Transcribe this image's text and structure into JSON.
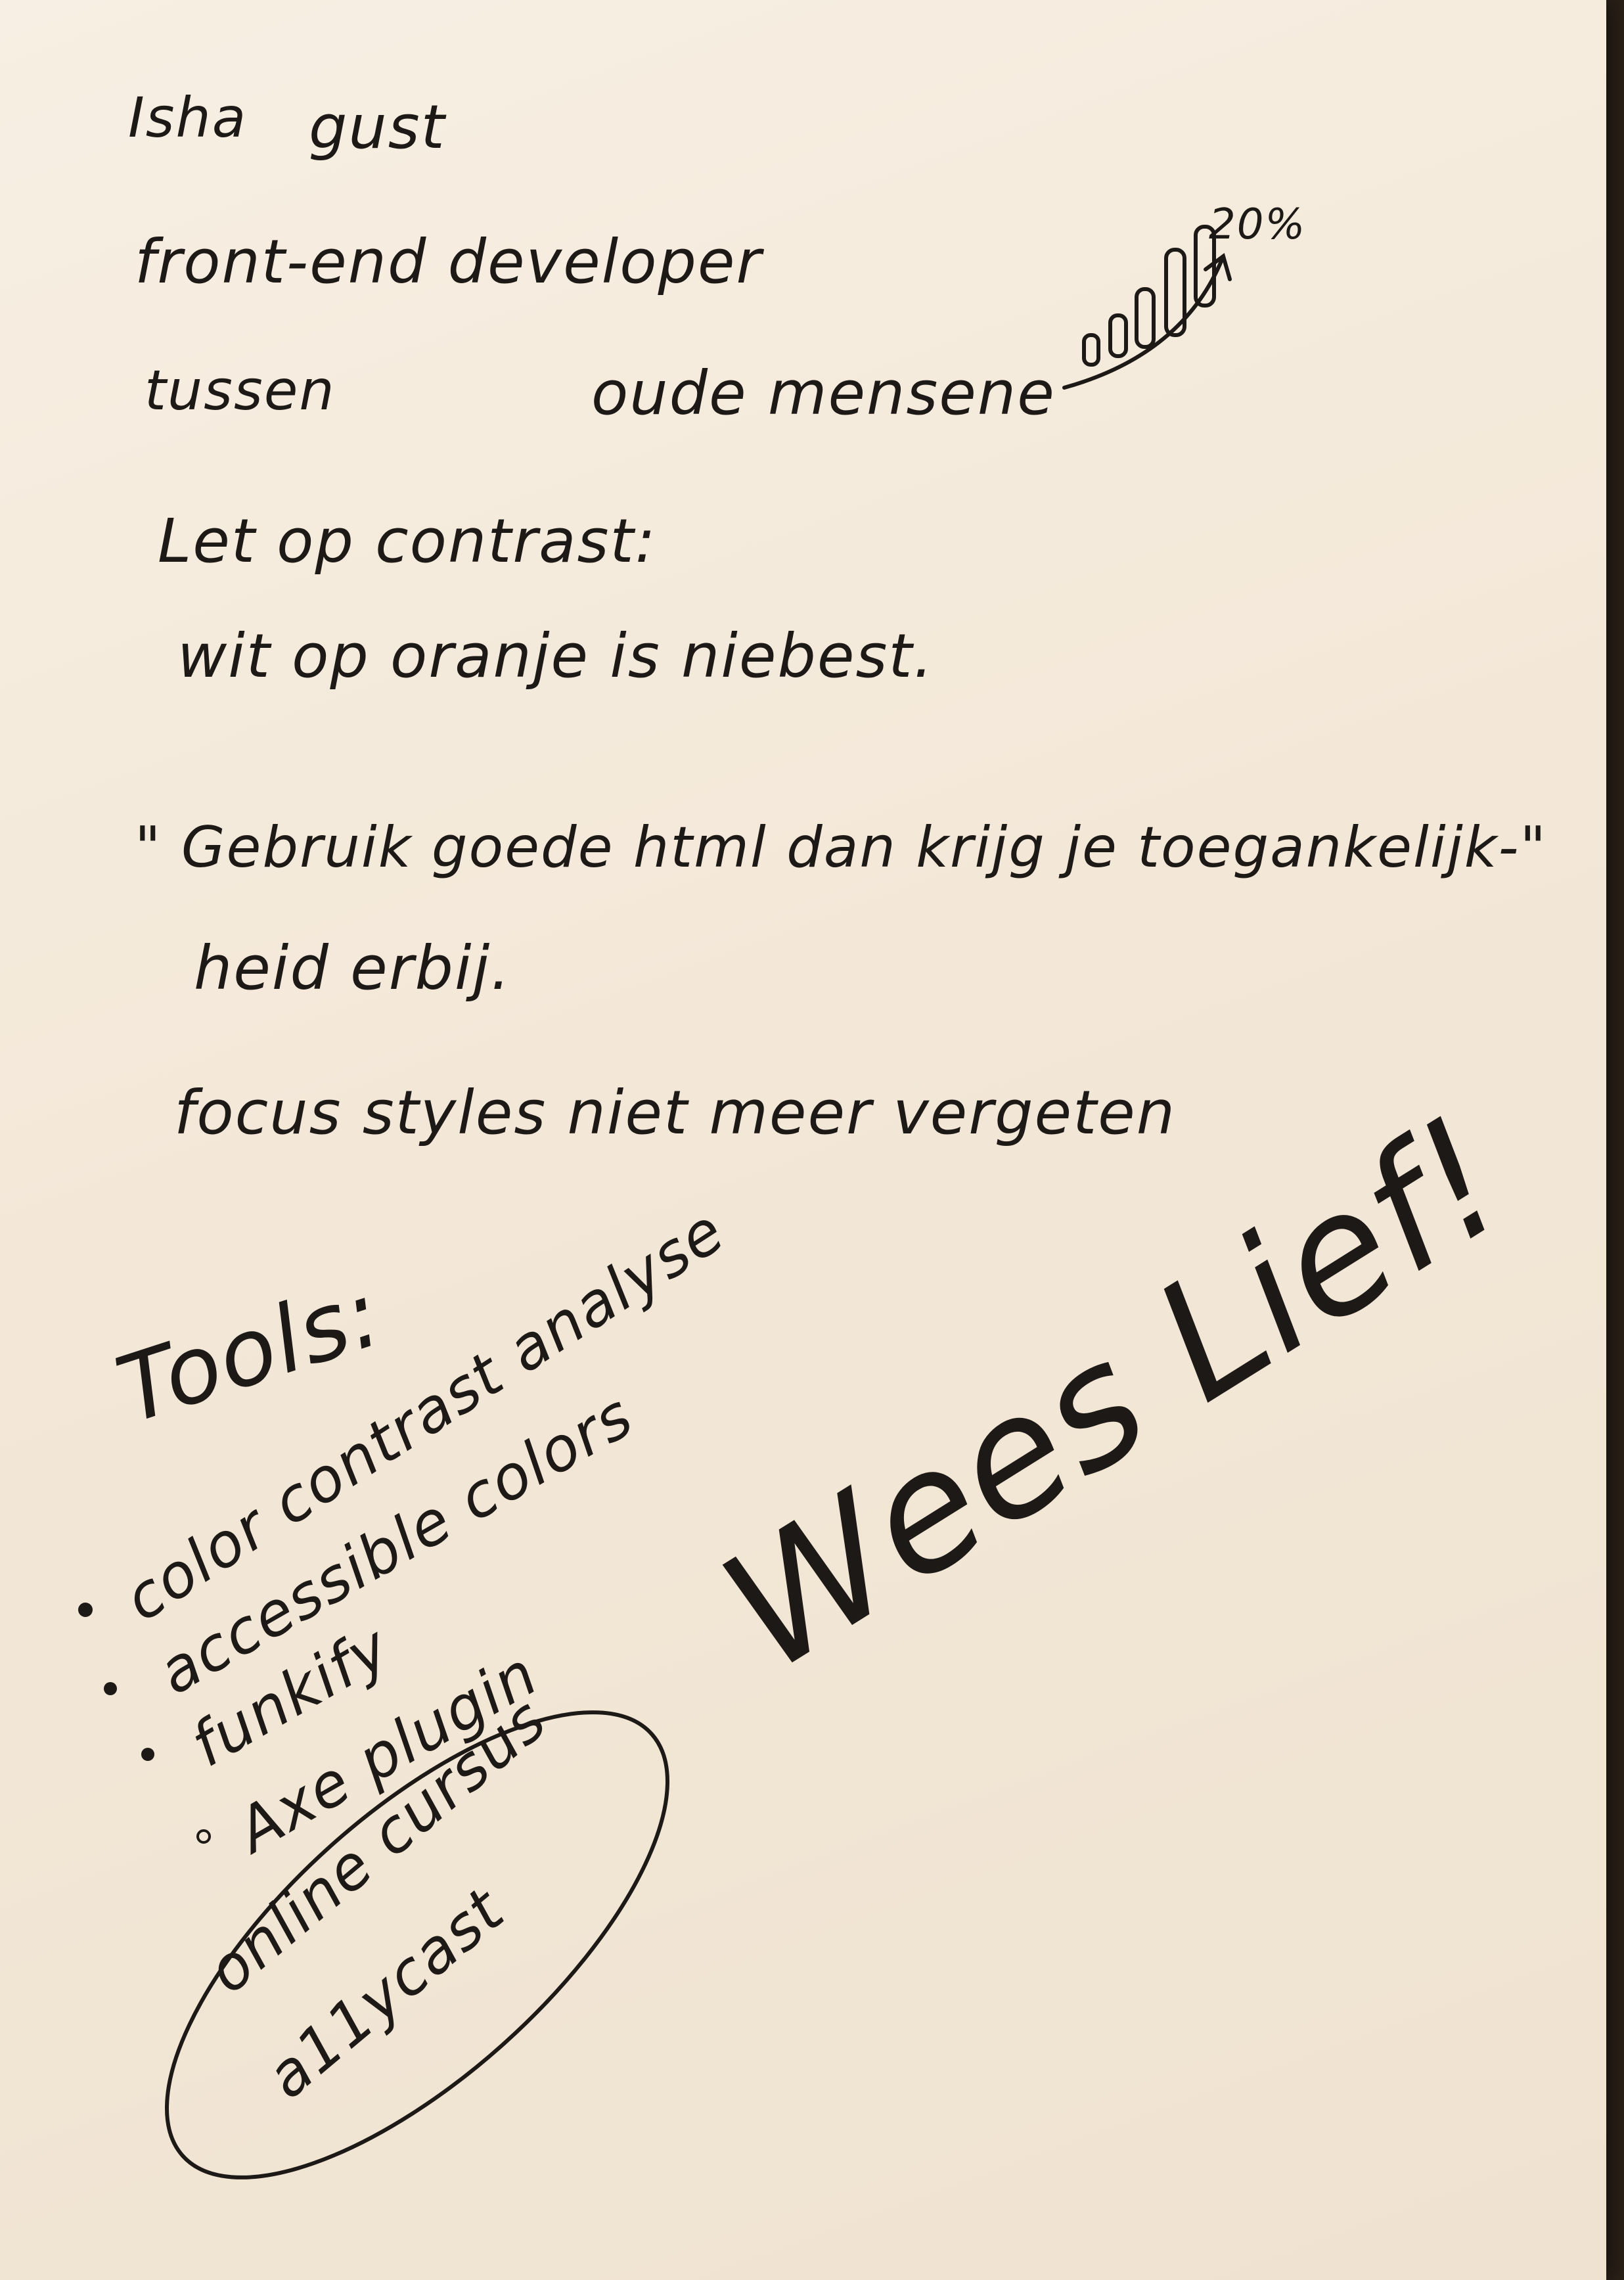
{
  "notes": {
    "name_prefix": "Isha",
    "name": "gust",
    "role": "front-end developer",
    "between": "tussen",
    "older_people": "oude mensene",
    "percent": "20%",
    "contrast_heading": "Let op contrast:",
    "contrast_note": "wit op oranje is niebest.",
    "quote_line1": "\" Gebruik goede html dan krijg je toegankelijk-\"",
    "quote_line2": "heid erbij.",
    "focus_note": "focus styles niet meer vergeten"
  },
  "tools": {
    "heading": "Tools:",
    "items": [
      "color contrast analyse",
      "accessible colors",
      "funkify",
      "Axe plugin"
    ]
  },
  "course": {
    "line1": "online cursus",
    "line2": "a11ycast"
  },
  "slogan": "Wees Lief!"
}
